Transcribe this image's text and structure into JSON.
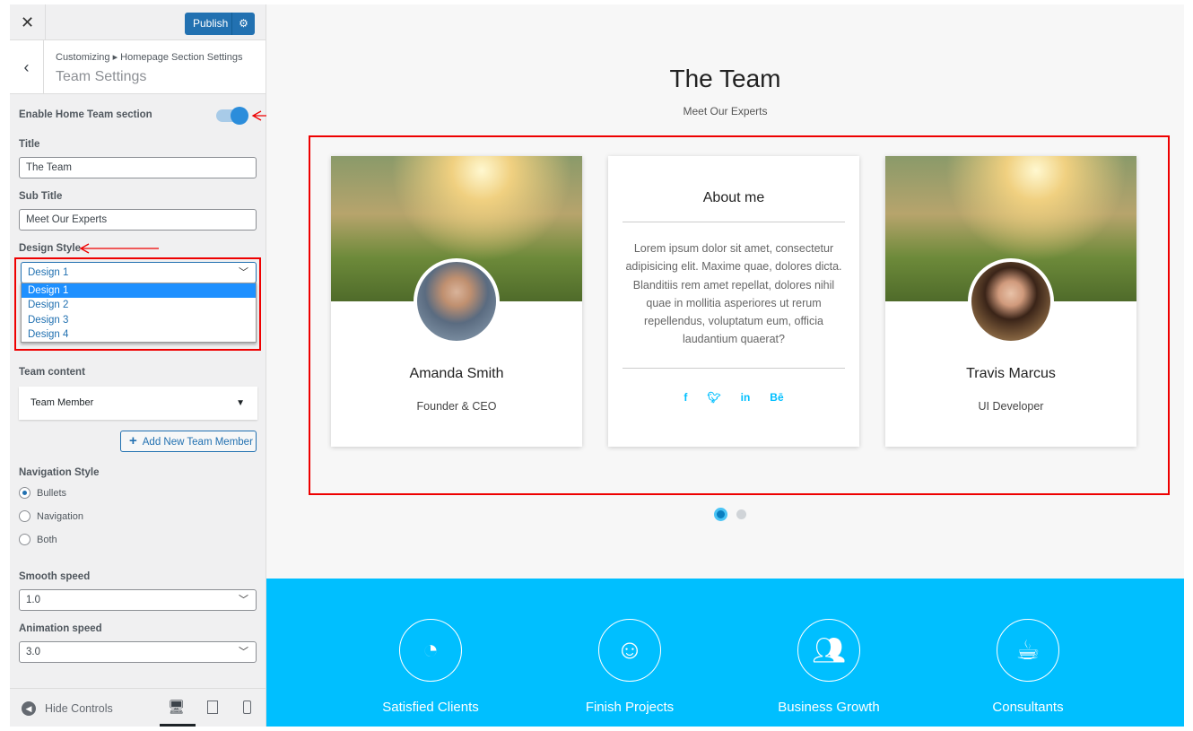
{
  "sidebar": {
    "close_icon": "close-icon",
    "publish_label": "Publish",
    "breadcrumb": "Customizing ▸ Homepage Section Settings",
    "panel_title": "Team Settings",
    "enable_label": "Enable Home Team section",
    "enable_on": true,
    "title_label": "Title",
    "title_value": "The Team",
    "subtitle_label": "Sub Title",
    "subtitle_value": "Meet Our Experts",
    "design_label": "Design Style",
    "design_value": "Design 1",
    "design_options": [
      "Design 1",
      "Design 2",
      "Design 3",
      "Design 4"
    ],
    "team_content_label": "Team content",
    "team_member_label": "Team Member",
    "add_member_label": "Add New Team Member",
    "nav_label": "Navigation Style",
    "nav_options": [
      "Bullets",
      "Navigation",
      "Both"
    ],
    "nav_selected": "Bullets",
    "smooth_label": "Smooth speed",
    "smooth_value": "1.0",
    "anim_label": "Animation speed",
    "anim_value": "3.0",
    "hide_controls": "Hide Controls"
  },
  "preview": {
    "title": "The Team",
    "subtitle": "Meet Our Experts",
    "members": [
      {
        "name": "Amanda Smith",
        "role": "Founder & CEO"
      },
      {
        "name": "Travis Marcus",
        "role": "UI Developer"
      }
    ],
    "about": {
      "heading": "About me",
      "text": "Lorem ipsum dolor sit amet, consectetur adipisicing elit. Maxime quae, dolores dicta. Blanditiis rem amet repellat, dolores nihil quae in mollitia asperiores ut rerum repellendus, voluptatum eum, officia laudantium quaerat?",
      "social": [
        "f",
        "t",
        "in",
        "Bē"
      ]
    },
    "stats": [
      "Satisfied Clients",
      "Finish Projects",
      "Business Growth",
      "Consultants"
    ],
    "accent": "#00bfff"
  }
}
